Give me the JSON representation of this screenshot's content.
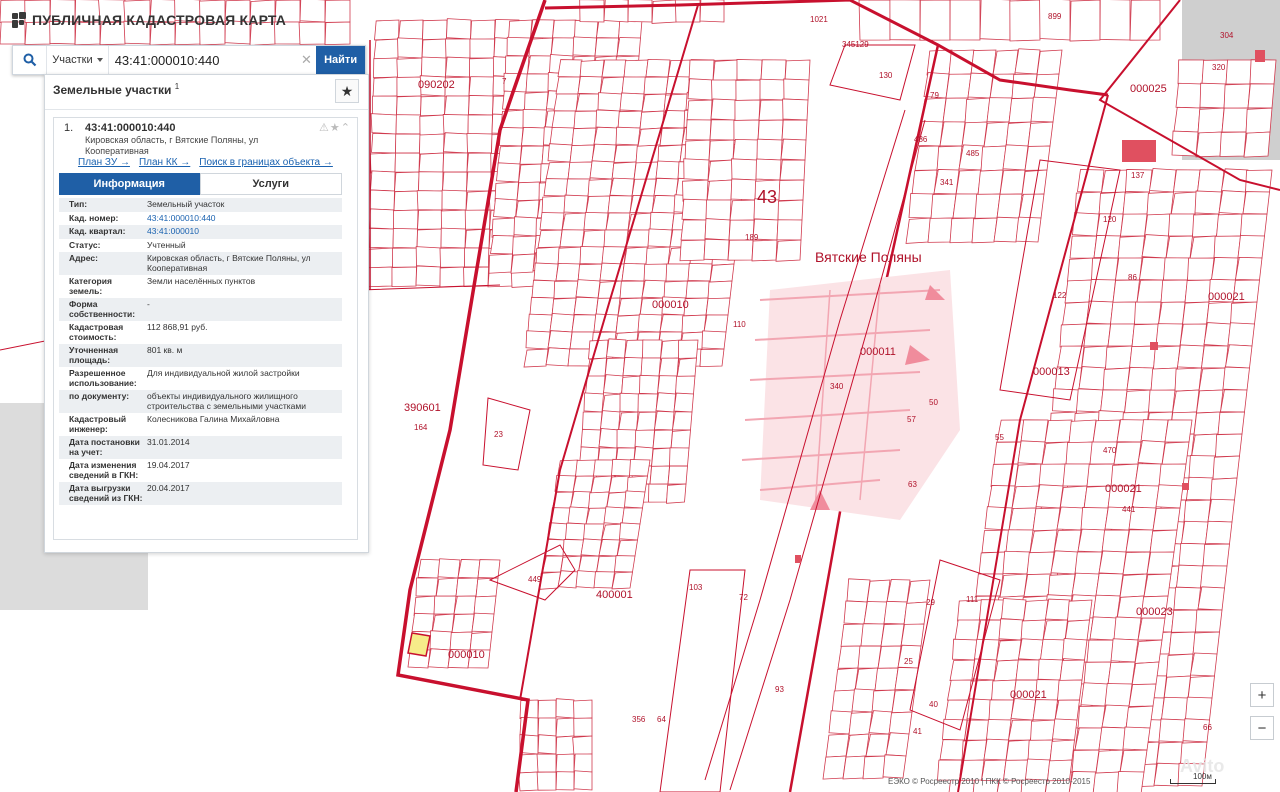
{
  "app": {
    "title": "ПУБЛИЧНАЯ КАДАСТРОВАЯ КАРТА"
  },
  "search": {
    "type_label": "Участки",
    "query": "43:41:000010:440",
    "button": "Найти"
  },
  "panel": {
    "title": "Земельные участки",
    "title_count": "1",
    "result": {
      "num": "1.",
      "cad_number": "43:41:000010:440",
      "address": "Кировская область, г Вятские Поляны, ул Кооперативная",
      "links": [
        "План ЗУ →",
        "План КК →",
        "Поиск в границах объекта →"
      ]
    },
    "tabs": {
      "info": "Информация",
      "services": "Услуги"
    },
    "rows": [
      {
        "k": "Тип:",
        "v": "Земельный участок"
      },
      {
        "k": "Кад. номер:",
        "v": "43:41:000010:440"
      },
      {
        "k": "Кад. квартал:",
        "v": "43:41:000010"
      },
      {
        "k": "Статус:",
        "v": "Учтенный"
      },
      {
        "k": "Адрес:",
        "v": "Кировская область, г Вятские Поляны, ул Кооперативная"
      },
      {
        "k": "Категория земель:",
        "v": "Земли населённых пунктов"
      },
      {
        "k": "Форма собственности:",
        "v": "-"
      },
      {
        "k": "Кадастровая стоимость:",
        "v": "112 868,91 руб."
      },
      {
        "k": "Уточненная площадь:",
        "v": "801 кв. м"
      },
      {
        "k": "Разрешенное использование:",
        "v": "Для индивидуальной жилой застройки"
      },
      {
        "k": "по документу:",
        "v": "объекты индивидуального жилищного строительства с земельными участками"
      },
      {
        "k": "Кадастровый инженер:",
        "v": "Колесникова Галина Михайловна"
      },
      {
        "k": "Дата постановки на учет:",
        "v": "31.01.2014"
      },
      {
        "k": "Дата изменения сведений в ГКН:",
        "v": "19.04.2017"
      },
      {
        "k": "Дата выгрузки сведений из ГКН:",
        "v": "20.04.2017"
      }
    ]
  },
  "map": {
    "city_label": "Вятские Поляны",
    "district_label": "43",
    "quarters": [
      "090202",
      "000010",
      "390601",
      "000011",
      "000013",
      "000021",
      "000025",
      "000023",
      "400001",
      "000010",
      "000021",
      "000021"
    ],
    "parcels": [
      "899",
      "130",
      "345129",
      "164",
      "23",
      "449",
      "340",
      "341",
      "122",
      "120",
      "86",
      "111",
      "72",
      "93",
      "63",
      "55",
      "137",
      "7",
      "1021",
      "304",
      "320",
      "486",
      "485",
      "79",
      "441",
      "470",
      "103",
      "356",
      "64",
      "66",
      "110",
      "189",
      "50",
      "57",
      "40",
      "41",
      "25",
      "29"
    ],
    "colors": {
      "line": "#c8102e",
      "fill": "#fbeaea",
      "highlight": "#f6ec8a",
      "building": "#e05060"
    }
  },
  "zoom": {
    "in": "+",
    "out": "−"
  },
  "footer": {
    "credits": "ЕЭКО © Росреестр 2010 | ПКК © Росреестр 2010-2015",
    "scale": "100м",
    "watermark": "Avito"
  }
}
